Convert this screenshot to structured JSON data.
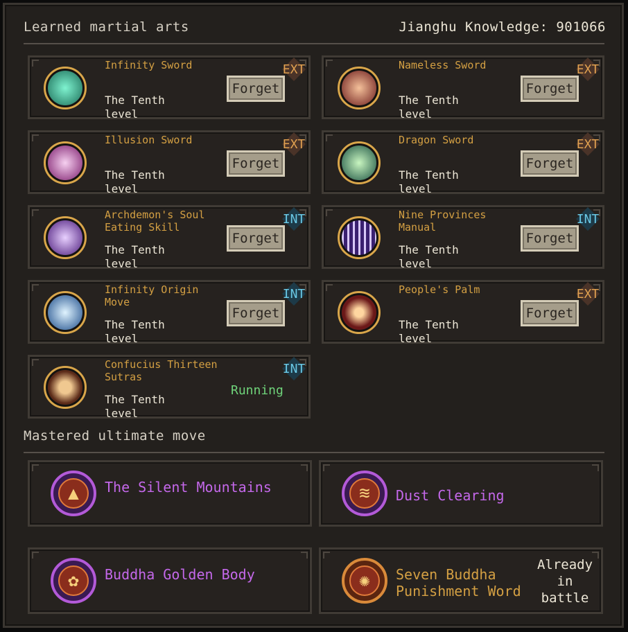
{
  "header": {
    "learned_title": "Learned martial arts",
    "knowledge_label": "Jianghu Knowledge: 901066",
    "ultimate_title": "Mastered ultimate move"
  },
  "arts": [
    {
      "name": "Infinity Sword",
      "level": "The Tenth level",
      "tag": "EXT",
      "action": "Forget",
      "icon": "sword-icon",
      "color": "#2aa38a"
    },
    {
      "name": "Nameless Sword",
      "level": "The Tenth level",
      "tag": "EXT",
      "action": "Forget",
      "icon": "sword-icon",
      "color": "#8a2a2a"
    },
    {
      "name": "Illusion Sword",
      "level": "The Tenth level",
      "tag": "EXT",
      "action": "Forget",
      "icon": "sword-icon",
      "color": "#a03a8a"
    },
    {
      "name": "Dragon Sword",
      "level": "The Tenth level",
      "tag": "EXT",
      "action": "Forget",
      "icon": "sword-icon",
      "color": "#2e7a5a"
    },
    {
      "name": "Archdemon's Soul Eating Skill",
      "level": "The Tenth level",
      "tag": "INT",
      "action": "Forget",
      "icon": "vortex-icon",
      "color": "#6a3aa8"
    },
    {
      "name": "Nine Provinces Manual",
      "level": "The Tenth level",
      "tag": "INT",
      "action": "Forget",
      "icon": "pillars-icon",
      "color": "#5a3a9a"
    },
    {
      "name": "Infinity Origin Move",
      "level": "The Tenth level",
      "tag": "INT",
      "action": "Forget",
      "icon": "swirl-icon",
      "color": "#2a6aa8"
    },
    {
      "name": "People's Palm",
      "level": "The Tenth level",
      "tag": "EXT",
      "action": "Forget",
      "icon": "burst-icon",
      "color": "#8a2a2a"
    },
    {
      "name": "Confucius Thirteen Sutras",
      "level": "The Tenth level",
      "tag": "INT",
      "action": "Running",
      "icon": "meditation-icon",
      "color": "#6a3a2a"
    }
  ],
  "ultimates": [
    {
      "name": "The Silent Mountains",
      "icon": "mountain-icon",
      "color": "#c468ea"
    },
    {
      "name": "Dust Clearing",
      "icon": "wave-icon",
      "color": "#c468ea"
    },
    {
      "name": "Buddha Golden Body",
      "icon": "lotus-icon",
      "color": "#c468ea"
    },
    {
      "name": "Seven Buddha Punishment Word",
      "icon": "mandala-icon",
      "color": "#d4a043",
      "status": "Already in battle"
    }
  ]
}
